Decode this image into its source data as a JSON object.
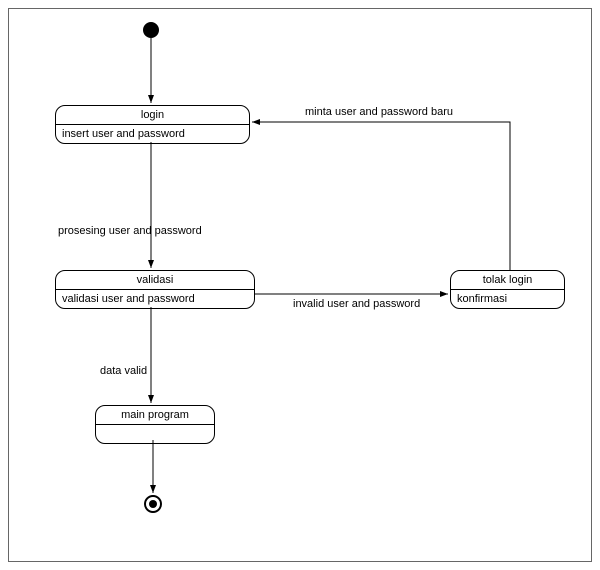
{
  "diagram": {
    "type": "uml-activity",
    "nodes": {
      "start": {
        "kind": "initial"
      },
      "login": {
        "title": "login",
        "subtitle": "insert user and password"
      },
      "validasi": {
        "title": "validasi",
        "subtitle": "validasi user and password"
      },
      "tolak": {
        "title": "tolak login",
        "subtitle": "konfirmasi"
      },
      "main": {
        "title": "main program",
        "subtitle": ""
      },
      "end": {
        "kind": "final"
      }
    },
    "edges": {
      "start_login": "",
      "login_validasi": "prosesing user and password",
      "validasi_tolak": "invalid user and password",
      "tolak_login": "minta user and password baru",
      "validasi_main": "data valid",
      "main_end": ""
    }
  }
}
